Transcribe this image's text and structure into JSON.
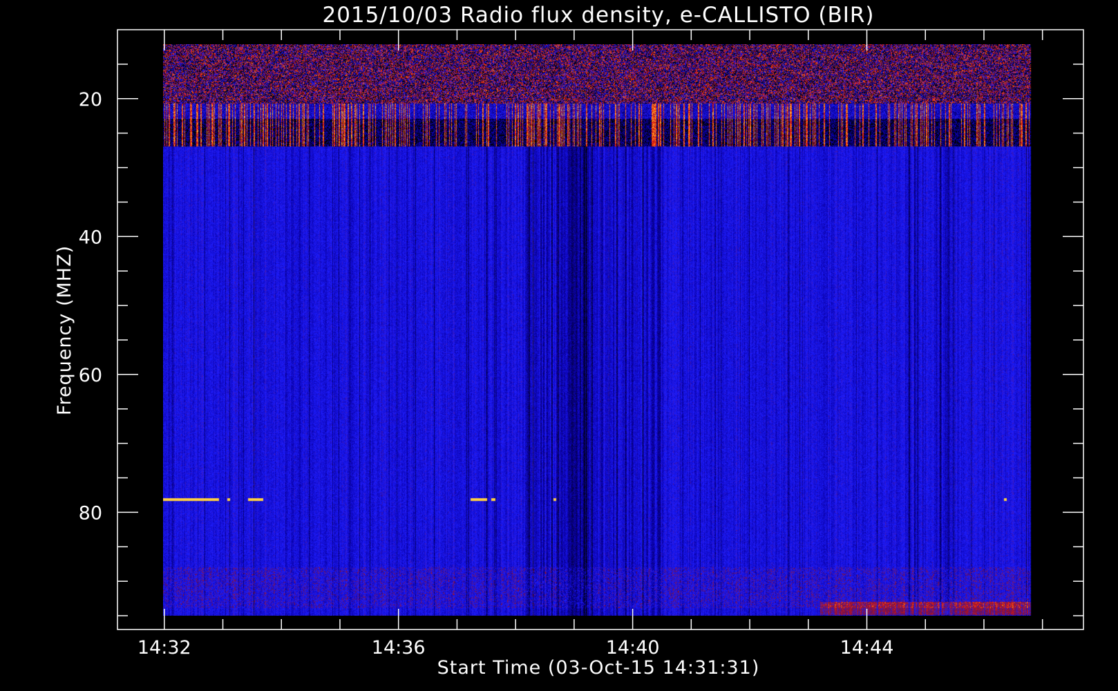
{
  "chart_data": {
    "type": "heatmap",
    "title": "2015/10/03  Radio flux density, e-CALLISTO (BIR)",
    "xlabel": "Start Time (03-Oct-15 14:31:31)",
    "ylabel": "Frequency (MHZ)",
    "x_tick_labels": [
      "14:32",
      "14:36",
      "14:40",
      "14:44"
    ],
    "x_tick_minutes": [
      32,
      36,
      40,
      44
    ],
    "x_range_minutes": [
      31.2,
      47.7
    ],
    "y_tick_labels": [
      "20",
      "40",
      "60",
      "80"
    ],
    "y_ticks": [
      20,
      40,
      60,
      80
    ],
    "y_range": [
      10,
      97
    ],
    "y_inverted": true,
    "data_extent": {
      "time_start_minute": 31.85,
      "time_end_minute": 46.8,
      "freq_min": 10,
      "freq_max": 95
    },
    "colormap": [
      "#000000",
      "#0a00a8",
      "#1e1eff",
      "#7a0f40",
      "#ff2000",
      "#ffa020",
      "#ffff80"
    ],
    "colors": {
      "background": "#000000",
      "axes": "#ffffff"
    }
  }
}
